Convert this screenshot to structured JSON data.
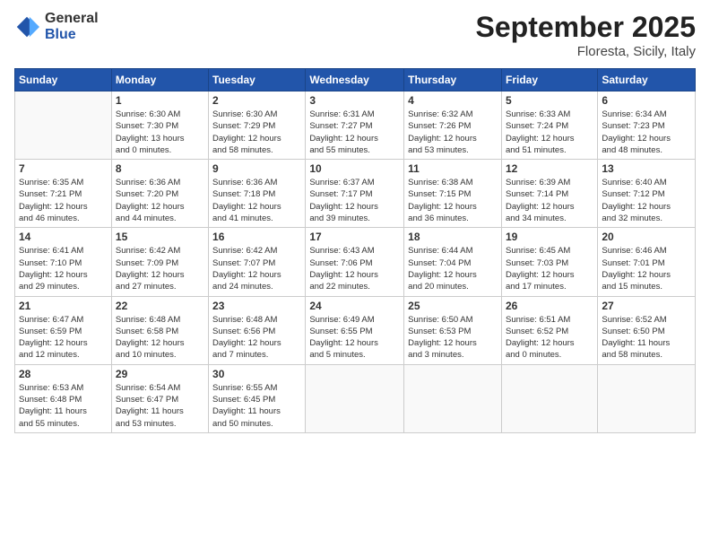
{
  "header": {
    "logo_general": "General",
    "logo_blue": "Blue",
    "title": "September 2025",
    "location": "Floresta, Sicily, Italy"
  },
  "days_of_week": [
    "Sunday",
    "Monday",
    "Tuesday",
    "Wednesday",
    "Thursday",
    "Friday",
    "Saturday"
  ],
  "weeks": [
    [
      {
        "num": "",
        "info": ""
      },
      {
        "num": "1",
        "info": "Sunrise: 6:30 AM\nSunset: 7:30 PM\nDaylight: 13 hours\nand 0 minutes."
      },
      {
        "num": "2",
        "info": "Sunrise: 6:30 AM\nSunset: 7:29 PM\nDaylight: 12 hours\nand 58 minutes."
      },
      {
        "num": "3",
        "info": "Sunrise: 6:31 AM\nSunset: 7:27 PM\nDaylight: 12 hours\nand 55 minutes."
      },
      {
        "num": "4",
        "info": "Sunrise: 6:32 AM\nSunset: 7:26 PM\nDaylight: 12 hours\nand 53 minutes."
      },
      {
        "num": "5",
        "info": "Sunrise: 6:33 AM\nSunset: 7:24 PM\nDaylight: 12 hours\nand 51 minutes."
      },
      {
        "num": "6",
        "info": "Sunrise: 6:34 AM\nSunset: 7:23 PM\nDaylight: 12 hours\nand 48 minutes."
      }
    ],
    [
      {
        "num": "7",
        "info": "Sunrise: 6:35 AM\nSunset: 7:21 PM\nDaylight: 12 hours\nand 46 minutes."
      },
      {
        "num": "8",
        "info": "Sunrise: 6:36 AM\nSunset: 7:20 PM\nDaylight: 12 hours\nand 44 minutes."
      },
      {
        "num": "9",
        "info": "Sunrise: 6:36 AM\nSunset: 7:18 PM\nDaylight: 12 hours\nand 41 minutes."
      },
      {
        "num": "10",
        "info": "Sunrise: 6:37 AM\nSunset: 7:17 PM\nDaylight: 12 hours\nand 39 minutes."
      },
      {
        "num": "11",
        "info": "Sunrise: 6:38 AM\nSunset: 7:15 PM\nDaylight: 12 hours\nand 36 minutes."
      },
      {
        "num": "12",
        "info": "Sunrise: 6:39 AM\nSunset: 7:14 PM\nDaylight: 12 hours\nand 34 minutes."
      },
      {
        "num": "13",
        "info": "Sunrise: 6:40 AM\nSunset: 7:12 PM\nDaylight: 12 hours\nand 32 minutes."
      }
    ],
    [
      {
        "num": "14",
        "info": "Sunrise: 6:41 AM\nSunset: 7:10 PM\nDaylight: 12 hours\nand 29 minutes."
      },
      {
        "num": "15",
        "info": "Sunrise: 6:42 AM\nSunset: 7:09 PM\nDaylight: 12 hours\nand 27 minutes."
      },
      {
        "num": "16",
        "info": "Sunrise: 6:42 AM\nSunset: 7:07 PM\nDaylight: 12 hours\nand 24 minutes."
      },
      {
        "num": "17",
        "info": "Sunrise: 6:43 AM\nSunset: 7:06 PM\nDaylight: 12 hours\nand 22 minutes."
      },
      {
        "num": "18",
        "info": "Sunrise: 6:44 AM\nSunset: 7:04 PM\nDaylight: 12 hours\nand 20 minutes."
      },
      {
        "num": "19",
        "info": "Sunrise: 6:45 AM\nSunset: 7:03 PM\nDaylight: 12 hours\nand 17 minutes."
      },
      {
        "num": "20",
        "info": "Sunrise: 6:46 AM\nSunset: 7:01 PM\nDaylight: 12 hours\nand 15 minutes."
      }
    ],
    [
      {
        "num": "21",
        "info": "Sunrise: 6:47 AM\nSunset: 6:59 PM\nDaylight: 12 hours\nand 12 minutes."
      },
      {
        "num": "22",
        "info": "Sunrise: 6:48 AM\nSunset: 6:58 PM\nDaylight: 12 hours\nand 10 minutes."
      },
      {
        "num": "23",
        "info": "Sunrise: 6:48 AM\nSunset: 6:56 PM\nDaylight: 12 hours\nand 7 minutes."
      },
      {
        "num": "24",
        "info": "Sunrise: 6:49 AM\nSunset: 6:55 PM\nDaylight: 12 hours\nand 5 minutes."
      },
      {
        "num": "25",
        "info": "Sunrise: 6:50 AM\nSunset: 6:53 PM\nDaylight: 12 hours\nand 3 minutes."
      },
      {
        "num": "26",
        "info": "Sunrise: 6:51 AM\nSunset: 6:52 PM\nDaylight: 12 hours\nand 0 minutes."
      },
      {
        "num": "27",
        "info": "Sunrise: 6:52 AM\nSunset: 6:50 PM\nDaylight: 11 hours\nand 58 minutes."
      }
    ],
    [
      {
        "num": "28",
        "info": "Sunrise: 6:53 AM\nSunset: 6:48 PM\nDaylight: 11 hours\nand 55 minutes."
      },
      {
        "num": "29",
        "info": "Sunrise: 6:54 AM\nSunset: 6:47 PM\nDaylight: 11 hours\nand 53 minutes."
      },
      {
        "num": "30",
        "info": "Sunrise: 6:55 AM\nSunset: 6:45 PM\nDaylight: 11 hours\nand 50 minutes."
      },
      {
        "num": "",
        "info": ""
      },
      {
        "num": "",
        "info": ""
      },
      {
        "num": "",
        "info": ""
      },
      {
        "num": "",
        "info": ""
      }
    ]
  ]
}
